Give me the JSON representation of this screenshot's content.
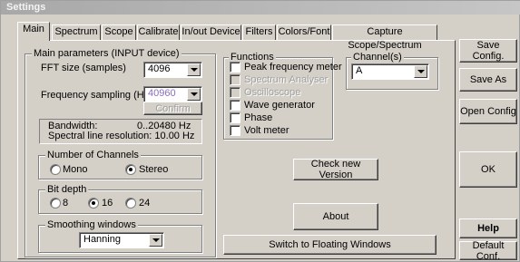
{
  "window": {
    "title": "Settings"
  },
  "tabs": [
    {
      "label": "Main"
    },
    {
      "label": "Spectrum"
    },
    {
      "label": "Scope"
    },
    {
      "label": "Calibrate"
    },
    {
      "label": "In/out Device"
    },
    {
      "label": "Filters"
    },
    {
      "label": "Colors/Font"
    },
    {
      "label": "Capture Scope/Spectrum"
    }
  ],
  "main_params": {
    "group_label": "Main parameters (INPUT device)",
    "fft_label": "FFT size (samples)",
    "fft_value": "4096",
    "fs_label": "Frequency sampling (Hz)",
    "fs_value": "40960",
    "confirm_label": "Confirm",
    "bandwidth_label": "Bandwidth:",
    "bandwidth_value": "0..20480 Hz",
    "resolution_label": "Spectral line resolution: 10.00 Hz"
  },
  "channels_count": {
    "label": "Number of Channels",
    "mono": "Mono",
    "stereo": "Stereo",
    "selected": "Stereo"
  },
  "bit_depth": {
    "label": "Bit depth",
    "opt8": "8",
    "opt16": "16",
    "opt24": "24",
    "selected": "16"
  },
  "smoothing": {
    "label": "Smoothing windows",
    "value": "Hanning"
  },
  "functions": {
    "label": "Functions",
    "items": [
      {
        "label": "Peak frequency meter",
        "enabled": true,
        "checked": false
      },
      {
        "label": "Spectrum Analyser",
        "enabled": false,
        "checked": false
      },
      {
        "label": "Oscilloscope",
        "enabled": false,
        "checked": false
      },
      {
        "label": "Wave generator",
        "enabled": true,
        "checked": false
      },
      {
        "label": "Phase",
        "enabled": true,
        "checked": false
      },
      {
        "label": "Volt meter",
        "enabled": true,
        "checked": false
      }
    ]
  },
  "channels": {
    "label": "Channel(s)",
    "value": "A"
  },
  "buttons": {
    "check_version": "Check new Version",
    "about": "About",
    "switch_floating": "Switch to Floating Windows",
    "save_config": "Save Config.",
    "save_as": "Save As",
    "open_config": "Open Config",
    "ok": "OK",
    "help": "Help",
    "default_conf": "Default Conf."
  }
}
